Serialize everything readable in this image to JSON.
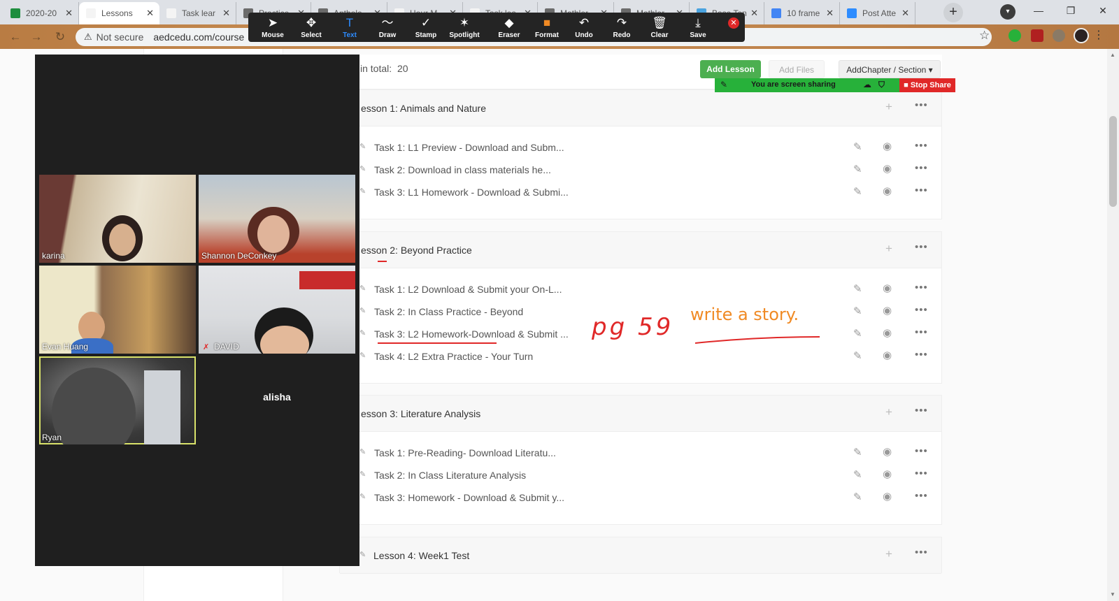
{
  "browser": {
    "tabs": [
      {
        "label": "2020-20",
        "fav": "#1e8e3e"
      },
      {
        "label": "Lessons",
        "fav": "#f4f4f4",
        "active": true
      },
      {
        "label": "Task lear",
        "fav": "#f4f4f4"
      },
      {
        "label": "Practice",
        "fav": "#6b6b6b"
      },
      {
        "label": "Anthole",
        "fav": "#6b6b6b"
      },
      {
        "label": "Hour M",
        "fav": "#f4f4f4"
      },
      {
        "label": "Task lea",
        "fav": "#f4f4f4"
      },
      {
        "label": "Mathler",
        "fav": "#6b6b6b"
      },
      {
        "label": "Mathler",
        "fav": "#6b6b6b"
      },
      {
        "label": "Base Ten",
        "fav": "#4aa3df"
      },
      {
        "label": "10 frame",
        "fav": "#4285f4"
      },
      {
        "label": "Post Atte",
        "fav": "#2d8cff"
      }
    ],
    "new_tab": "+",
    "security": "Not secure",
    "url": "aedcedu.com/course"
  },
  "zoom_toolbar": {
    "tools": [
      {
        "label": "Mouse",
        "icon": "➤"
      },
      {
        "label": "Select",
        "icon": "✥"
      },
      {
        "label": "Text",
        "icon": "T",
        "active": true
      },
      {
        "label": "Draw",
        "icon": "〜"
      },
      {
        "label": "Stamp",
        "icon": "✓"
      },
      {
        "label": "Spotlight",
        "icon": "✶"
      },
      {
        "label": "Eraser",
        "icon": "◆"
      },
      {
        "label": "Format",
        "icon": "■"
      },
      {
        "label": "Undo",
        "icon": "↶"
      },
      {
        "label": "Redo",
        "icon": "↷"
      },
      {
        "label": "Clear",
        "icon": "🗑"
      },
      {
        "label": "Save",
        "icon": "⤓"
      }
    ],
    "close": "✕"
  },
  "course": {
    "total_label": "in total:",
    "total_value": "20",
    "add_lesson": "Add Lesson",
    "add_files": "Add Files",
    "add_chapter": "AddChapter / Section ▾"
  },
  "screen_share": {
    "status": "You are screen sharing",
    "stop": "Stop Share"
  },
  "lessons": [
    {
      "title": "esson 1:   Animals and Nature",
      "tasks": [
        "Task 1:   L1 Preview - Download and Subm...",
        "Task 2:   Download in class materials he...",
        "Task 3:   L1 Homework - Download & Submi..."
      ]
    },
    {
      "title": "esson 2:   Beyond Practice",
      "tasks": [
        "Task 1:   L2 Download & Submit your On-L...",
        "Task 2:   In Class Practice - Beyond",
        "Task 3:   L2 Homework-Download & Submit ...",
        "Task 4:   L2 Extra Practice - Your Turn"
      ]
    },
    {
      "title": "esson 3:   Literature Analysis",
      "tasks": [
        "Task 1:   Pre-Reading- Download Literatu...",
        "Task 2:   In Class Literature Analysis",
        "Task 3:   Homework - Download & Submit y..."
      ]
    },
    {
      "title": "Lesson 4:   Week1 Test",
      "tasks": []
    }
  ],
  "participants": {
    "karina": "karina",
    "shannon": "Shannon DeConkey",
    "evan": "Evan Huang",
    "david": "DAVID",
    "ryan": "Ryan",
    "alisha": "alisha"
  },
  "annotations": {
    "pg": "pg 59",
    "story": "write a story."
  },
  "colors": {
    "accent_green": "#4caf50",
    "share_green": "#27b13a",
    "stop_red": "#e02828",
    "zoom_blue": "#2d8cff",
    "annotation_red": "#e02828",
    "annotation_orange": "#f08a24"
  }
}
